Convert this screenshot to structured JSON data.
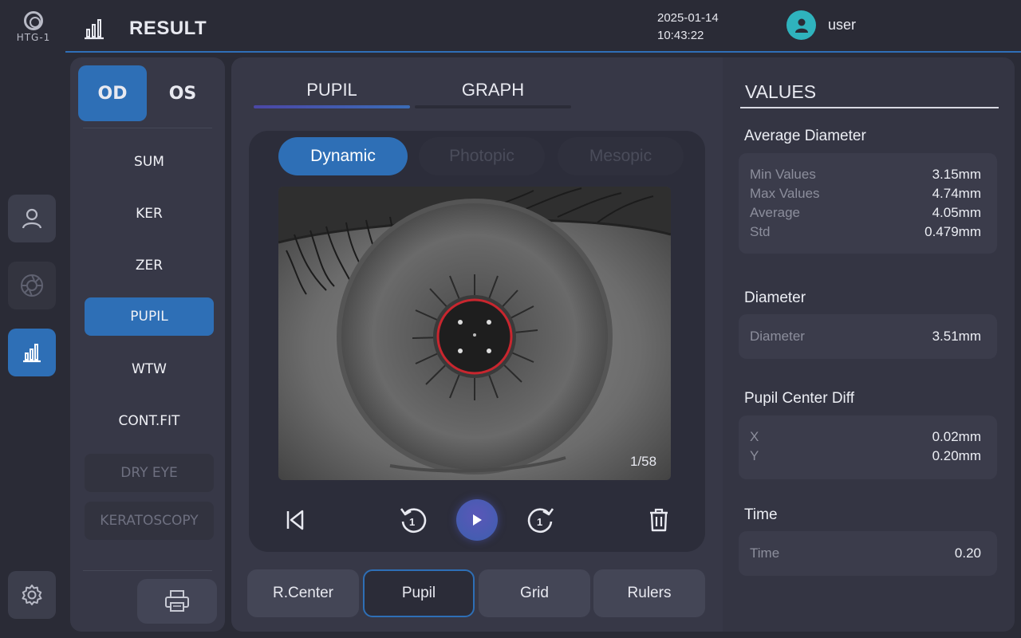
{
  "app": {
    "logo_text": "HTG-1"
  },
  "header": {
    "title": "RESULT",
    "date": "2025-01-14",
    "time": "10:43:22",
    "user": "user"
  },
  "rail": {
    "items": [
      {
        "icon": "user-icon",
        "state": "normal"
      },
      {
        "icon": "aperture-icon",
        "state": "dim"
      },
      {
        "icon": "bar-chart-icon",
        "state": "active"
      },
      {
        "icon": "gear-icon",
        "state": "normal"
      }
    ]
  },
  "eye_toggle": {
    "od": "OD",
    "os": "OS",
    "selected": "OD"
  },
  "menu": {
    "items": [
      {
        "label": "SUM",
        "state": "normal"
      },
      {
        "label": "KER",
        "state": "normal"
      },
      {
        "label": "ZER",
        "state": "normal"
      },
      {
        "label": "PUPIL",
        "state": "active"
      },
      {
        "label": "WTW",
        "state": "normal"
      },
      {
        "label": "CONT.FIT",
        "state": "normal"
      },
      {
        "label": "DRY EYE",
        "state": "disabled"
      },
      {
        "label": "KERATOSCOPY",
        "state": "disabled"
      }
    ],
    "print_icon": "printer-icon"
  },
  "tabs": [
    {
      "label": "PUPIL",
      "active": true
    },
    {
      "label": "GRAPH",
      "active": false
    }
  ],
  "modes": [
    {
      "label": "Dynamic",
      "state": "active"
    },
    {
      "label": "Photopic",
      "state": "disabled"
    },
    {
      "label": "Mesopic",
      "state": "disabled"
    }
  ],
  "player": {
    "frame": "1/58",
    "rewind_step": "1",
    "forward_step": "1"
  },
  "tools": [
    {
      "label": "R.Center",
      "active": false
    },
    {
      "label": "Pupil",
      "active": true
    },
    {
      "label": "Grid",
      "active": false
    },
    {
      "label": "Rulers",
      "active": false
    }
  ],
  "values": {
    "title": "VALUES",
    "average_diameter": {
      "title": "Average Diameter",
      "rows": [
        {
          "label": "Min Values",
          "value": "3.15mm"
        },
        {
          "label": "Max Values",
          "value": "4.74mm"
        },
        {
          "label": "Average",
          "value": "4.05mm"
        },
        {
          "label": "Std",
          "value": "0.479mm"
        }
      ]
    },
    "diameter": {
      "title": "Diameter",
      "rows": [
        {
          "label": "Diameter",
          "value": "3.51mm"
        }
      ]
    },
    "center_diff": {
      "title": "Pupil Center Diff",
      "rows": [
        {
          "label": "X",
          "value": "0.02mm"
        },
        {
          "label": "Y",
          "value": "0.20mm"
        }
      ]
    },
    "time": {
      "title": "Time",
      "rows": [
        {
          "label": "Time",
          "value": "0.20"
        }
      ]
    }
  },
  "colors": {
    "accent": "#2e6fb6",
    "teal_avatar": "#2fb3bd",
    "pupil_ring": "#c8262e",
    "background": "#2a2b36"
  }
}
